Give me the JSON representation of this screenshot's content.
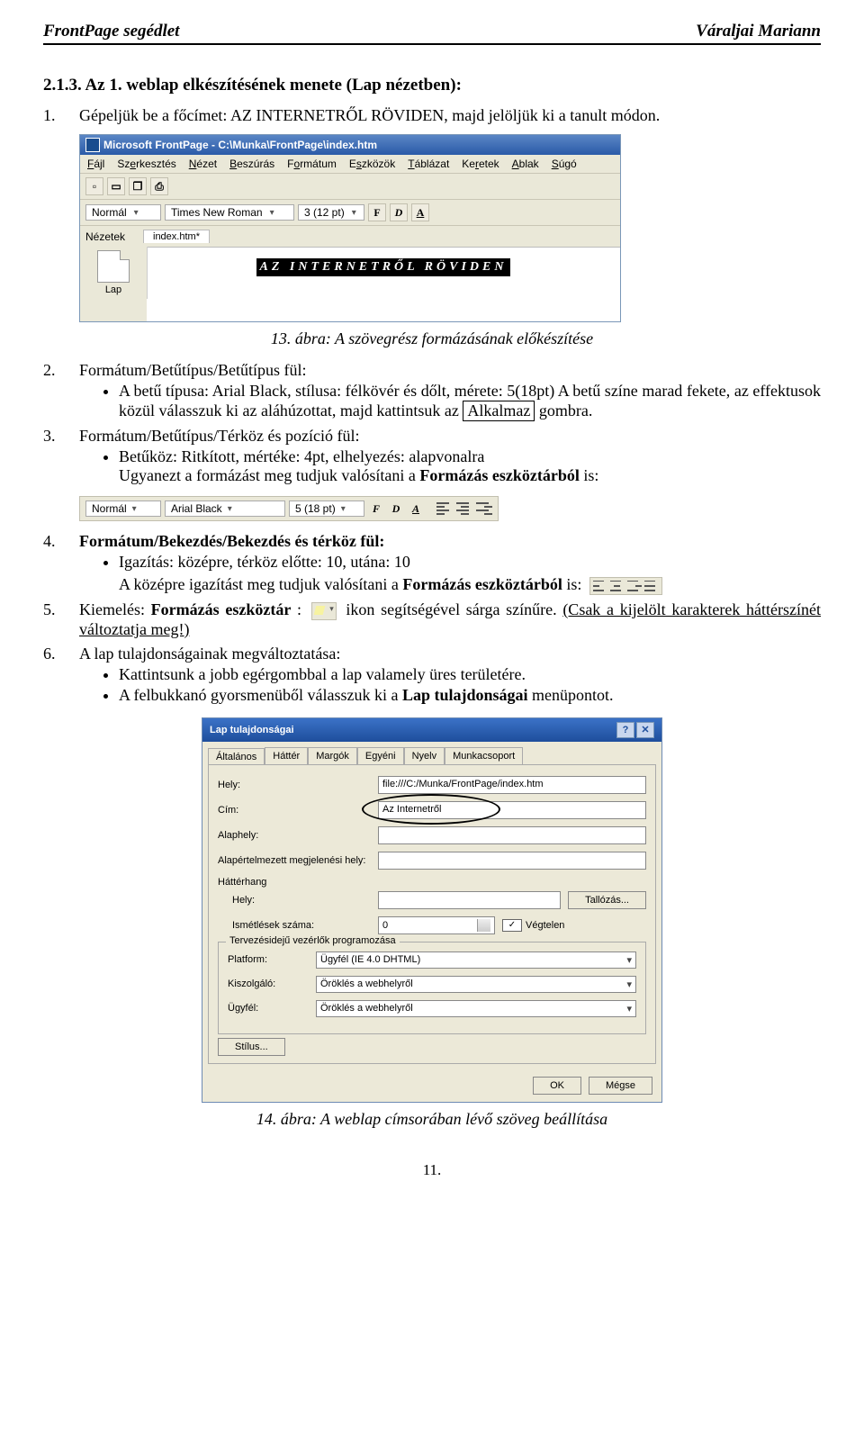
{
  "header": {
    "left": "FrontPage segédlet",
    "right": "Váraljai Mariann"
  },
  "section": {
    "title": "2.1.3. Az 1. weblap elkészítésének menete (Lap nézetben):"
  },
  "step1": {
    "num": "1.",
    "text_a": "Gépeljük be a főcímet: AZ INTERNETRŐL RÖVIDEN, majd jelöljük ki a tanult módon."
  },
  "fp": {
    "title": "Microsoft FrontPage - C:\\Munka\\FrontPage\\index.htm",
    "menus": [
      "Fájl",
      "Szerkesztés",
      "Nézet",
      "Beszúrás",
      "Formátum",
      "Eszközök",
      "Táblázat",
      "Keretek",
      "Ablak",
      "Súgó"
    ],
    "style": "Normál",
    "font": "Times New Roman",
    "size": "3 (12 pt)",
    "viewslabel": "Nézetek",
    "tab": "index.htm*",
    "lap": "Lap",
    "sel_text": "AZ INTERNETRŐL RÖVIDEN"
  },
  "caption13": "13. ábra: A szövegrész formázásának előkészítése",
  "step2": {
    "num": "2.",
    "title": "Formátum/Betűtípus/Betűtípus fül:",
    "bullet": "A betű típusa: Arial Black, stílusa: félkövér és dőlt, mérete: 5(18pt) A betű színe marad fekete, az effektusok közül válasszuk ki az aláhúzottat, majd kattintsuk az ",
    "box": "Alkalmaz",
    "after": " gombra."
  },
  "step3": {
    "num": "3.",
    "title": "Formátum/Betűtípus/Térköz és pozíció fül",
    "bullet_a": "Betűköz: Ritkított, mértéke: 4pt, elhelyezés: alapvonalra",
    "bullet_b": "Ugyanezt a formázást meg tudjuk valósítani a ",
    "bullet_b_bold": "Formázás eszköztárból",
    "bullet_b_after": " is:"
  },
  "fmtbar": {
    "style": "Normál",
    "font": "Arial Black",
    "size": "5 (18 pt)"
  },
  "step4": {
    "num": "4.",
    "title": "Formátum/Bekezdés/Bekezdés és térköz fül:",
    "bullet": "Igazítás: középre, térköz előtte: 10, utána: 10",
    "line2_a": "A középre igazítást meg tudjuk valósítani a ",
    "line2_bold": "Formázás eszköztárból",
    "line2_after": " is:"
  },
  "step5": {
    "num": "5.",
    "a": "Kiemelés: ",
    "b": "Formázás eszköztár",
    "c": ": ",
    "d": " ikon segítségével sárga színűre. ",
    "e": "(Csak a kijelölt karakterek háttérszínét változtatja meg!)"
  },
  "step6": {
    "num": "6.",
    "title": "A lap tulajdonságainak megváltoztatása:",
    "b1": "Kattintsunk a jobb egérgombbal a lap valamely üres területére.",
    "b2_a": "A felbukkanó gyorsmenüből válasszuk ki a ",
    "b2_bold": "Lap tulajdonságai",
    "b2_after": " menüpontot."
  },
  "dlg": {
    "title": "Lap tulajdonságai",
    "tabs": [
      "Általános",
      "Háttér",
      "Margók",
      "Egyéni",
      "Nyelv",
      "Munkacsoport"
    ],
    "hely_l": "Hely:",
    "hely_v": "file:///C:/Munka/FrontPage/index.htm",
    "cim_l": "Cím:",
    "cim_v": "Az Internetről",
    "alap_l": "Alaphely:",
    "alapm_l": "Alapértelmezett megjelenési hely:",
    "hh": "Háttérhang",
    "hh_hely": "Hely:",
    "tall": "Tallózás...",
    "ism_l": "Ismétlések száma:",
    "ism_v": "0",
    "veg": "Végtelen",
    "grp": "Tervezésidejű vezérlők programozása",
    "plat_l": "Platform:",
    "plat_v": "Ügyfél (IE 4.0 DHTML)",
    "kisz_l": "Kiszolgáló:",
    "kisz_v": "Öröklés a webhelyről",
    "ugy_l": "Ügyfél:",
    "ugy_v": "Öröklés a webhelyről",
    "stilus": "Stílus...",
    "ok": "OK",
    "megse": "Mégse"
  },
  "caption14": "14. ábra: A weblap címsorában lévő szöveg beállítása",
  "pagenum": "11."
}
